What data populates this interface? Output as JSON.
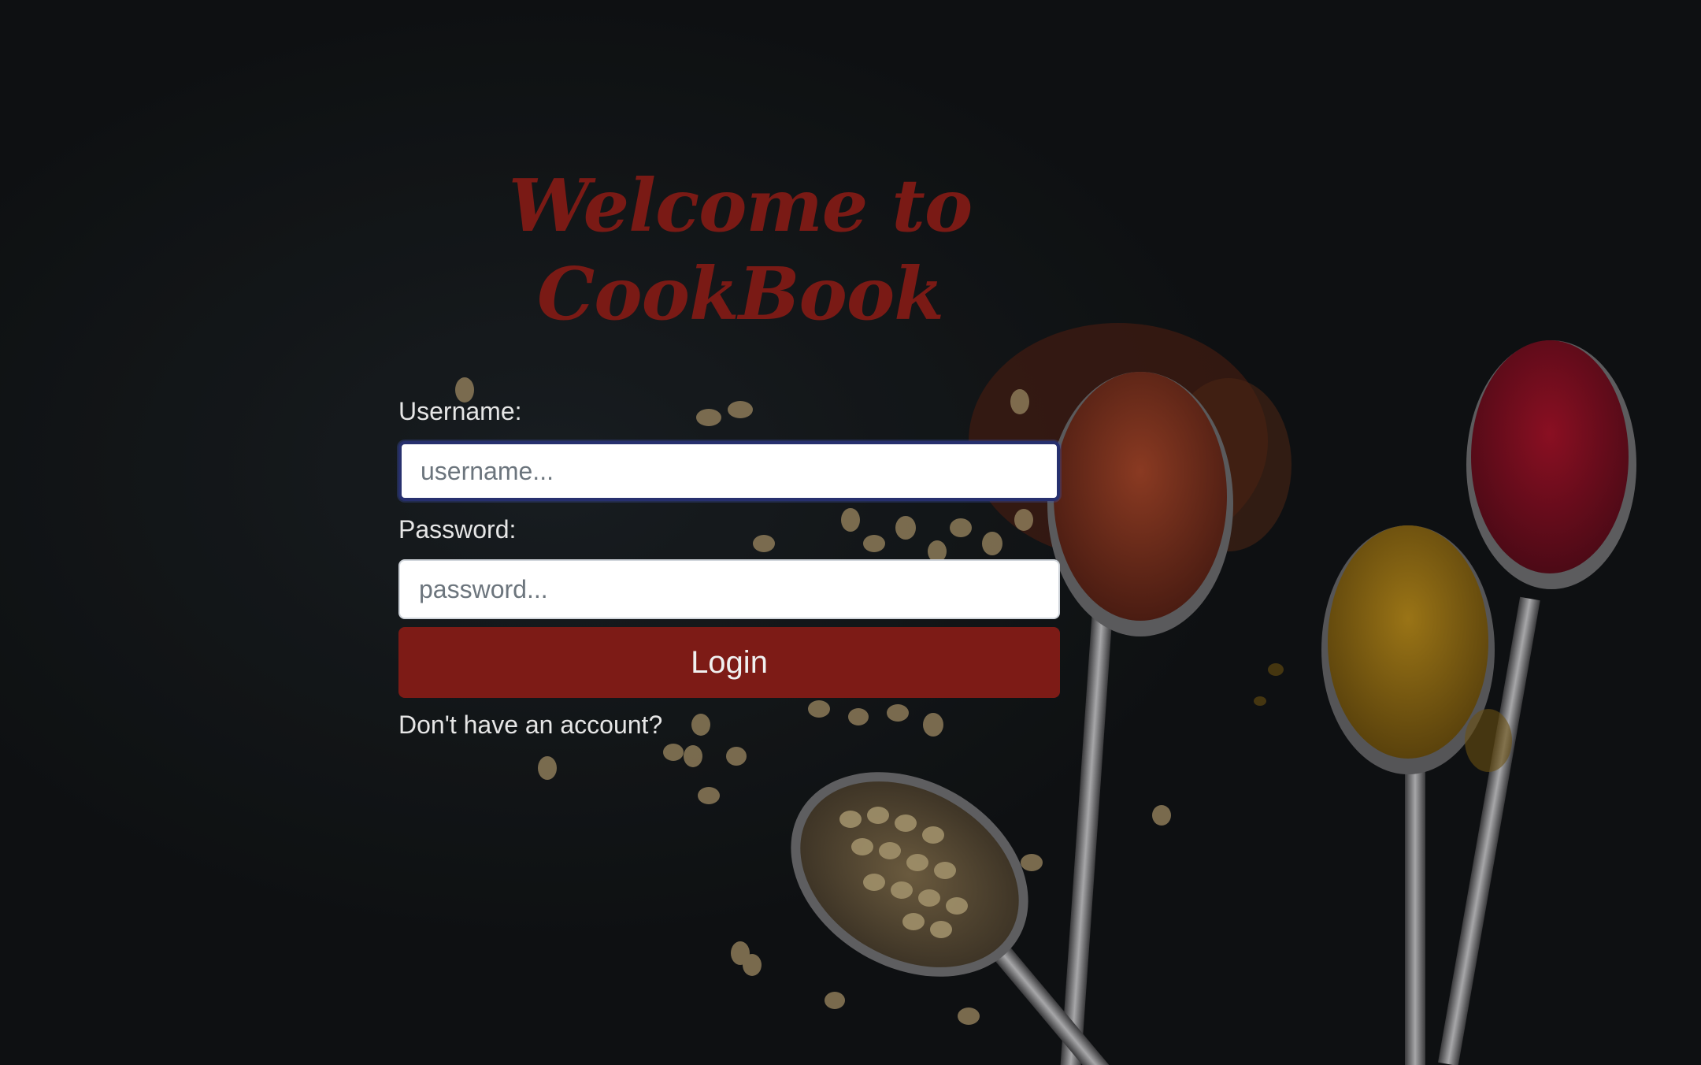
{
  "header": {
    "title_line1": "Welcome to",
    "title_line2": "CookBook"
  },
  "form": {
    "username_label": "Username:",
    "username_placeholder": "username...",
    "username_value": "",
    "password_label": "Password:",
    "password_placeholder": "password...",
    "password_value": "",
    "login_label": "Login",
    "signup_prompt": "Don't have an account?"
  },
  "colors": {
    "title": "#7a1a15",
    "button": "#7d1b16",
    "focus_border": "#27306e",
    "background": "#15181b"
  },
  "background_image": "dark-table-with-spice-spoons"
}
